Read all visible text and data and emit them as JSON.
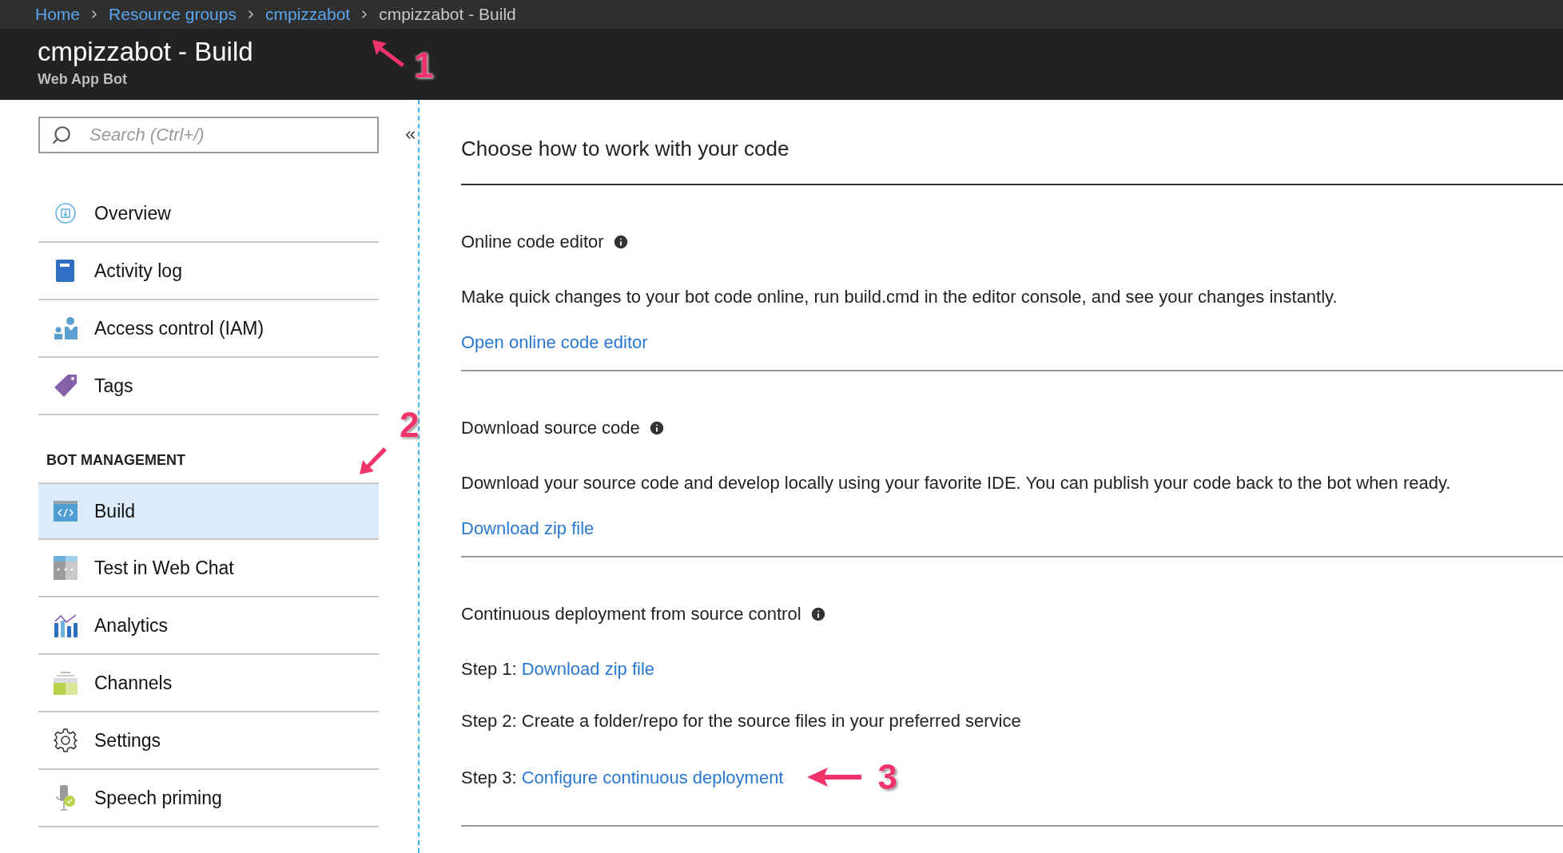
{
  "breadcrumb": [
    {
      "label": "Home",
      "kind": "link"
    },
    {
      "label": "Resource groups",
      "kind": "link"
    },
    {
      "label": "cmpizzabot",
      "kind": "link"
    },
    {
      "label": "cmpizzabot - Build",
      "kind": "current"
    }
  ],
  "header": {
    "title": "cmpizzabot - Build",
    "subtitle": "Web App Bot"
  },
  "sidebar": {
    "search": {
      "placeholder": "Search (Ctrl+/)"
    },
    "groups": [
      {
        "items": [
          {
            "label": "Overview",
            "selected": false
          },
          {
            "label": "Activity log",
            "selected": false
          },
          {
            "label": "Access control (IAM)",
            "selected": false
          },
          {
            "label": "Tags",
            "selected": false
          }
        ]
      },
      {
        "heading": "BOT MANAGEMENT",
        "items": [
          {
            "label": "Build",
            "selected": true
          },
          {
            "label": "Test in Web Chat",
            "selected": false
          },
          {
            "label": "Analytics",
            "selected": false
          },
          {
            "label": "Channels",
            "selected": false
          },
          {
            "label": "Settings",
            "selected": false
          },
          {
            "label": "Speech priming",
            "selected": false
          }
        ]
      }
    ]
  },
  "main": {
    "title": "Choose how to work with your code",
    "sections": [
      {
        "kind": "link",
        "title": "Online code editor",
        "description": "Make quick changes to your bot code online, run build.cmd in the editor console, and see your changes instantly.",
        "link": "Open online code editor"
      },
      {
        "kind": "link",
        "title": "Download source code",
        "description": "Download your source code and develop locally using your favorite IDE. You can publish your code back to the bot when ready.",
        "link": "Download zip file"
      },
      {
        "kind": "steps",
        "title": "Continuous deployment from source control",
        "steps": [
          {
            "prefix": "Step 1:",
            "link": "Download zip file"
          },
          {
            "prefix": "Step 2: Create a folder/repo for the source files in your preferred service"
          },
          {
            "prefix": "Step 3:",
            "link": "Configure continuous deployment"
          }
        ]
      }
    ]
  },
  "annotations": [
    {
      "label": "1"
    },
    {
      "label": "2"
    },
    {
      "label": "3"
    }
  ]
}
